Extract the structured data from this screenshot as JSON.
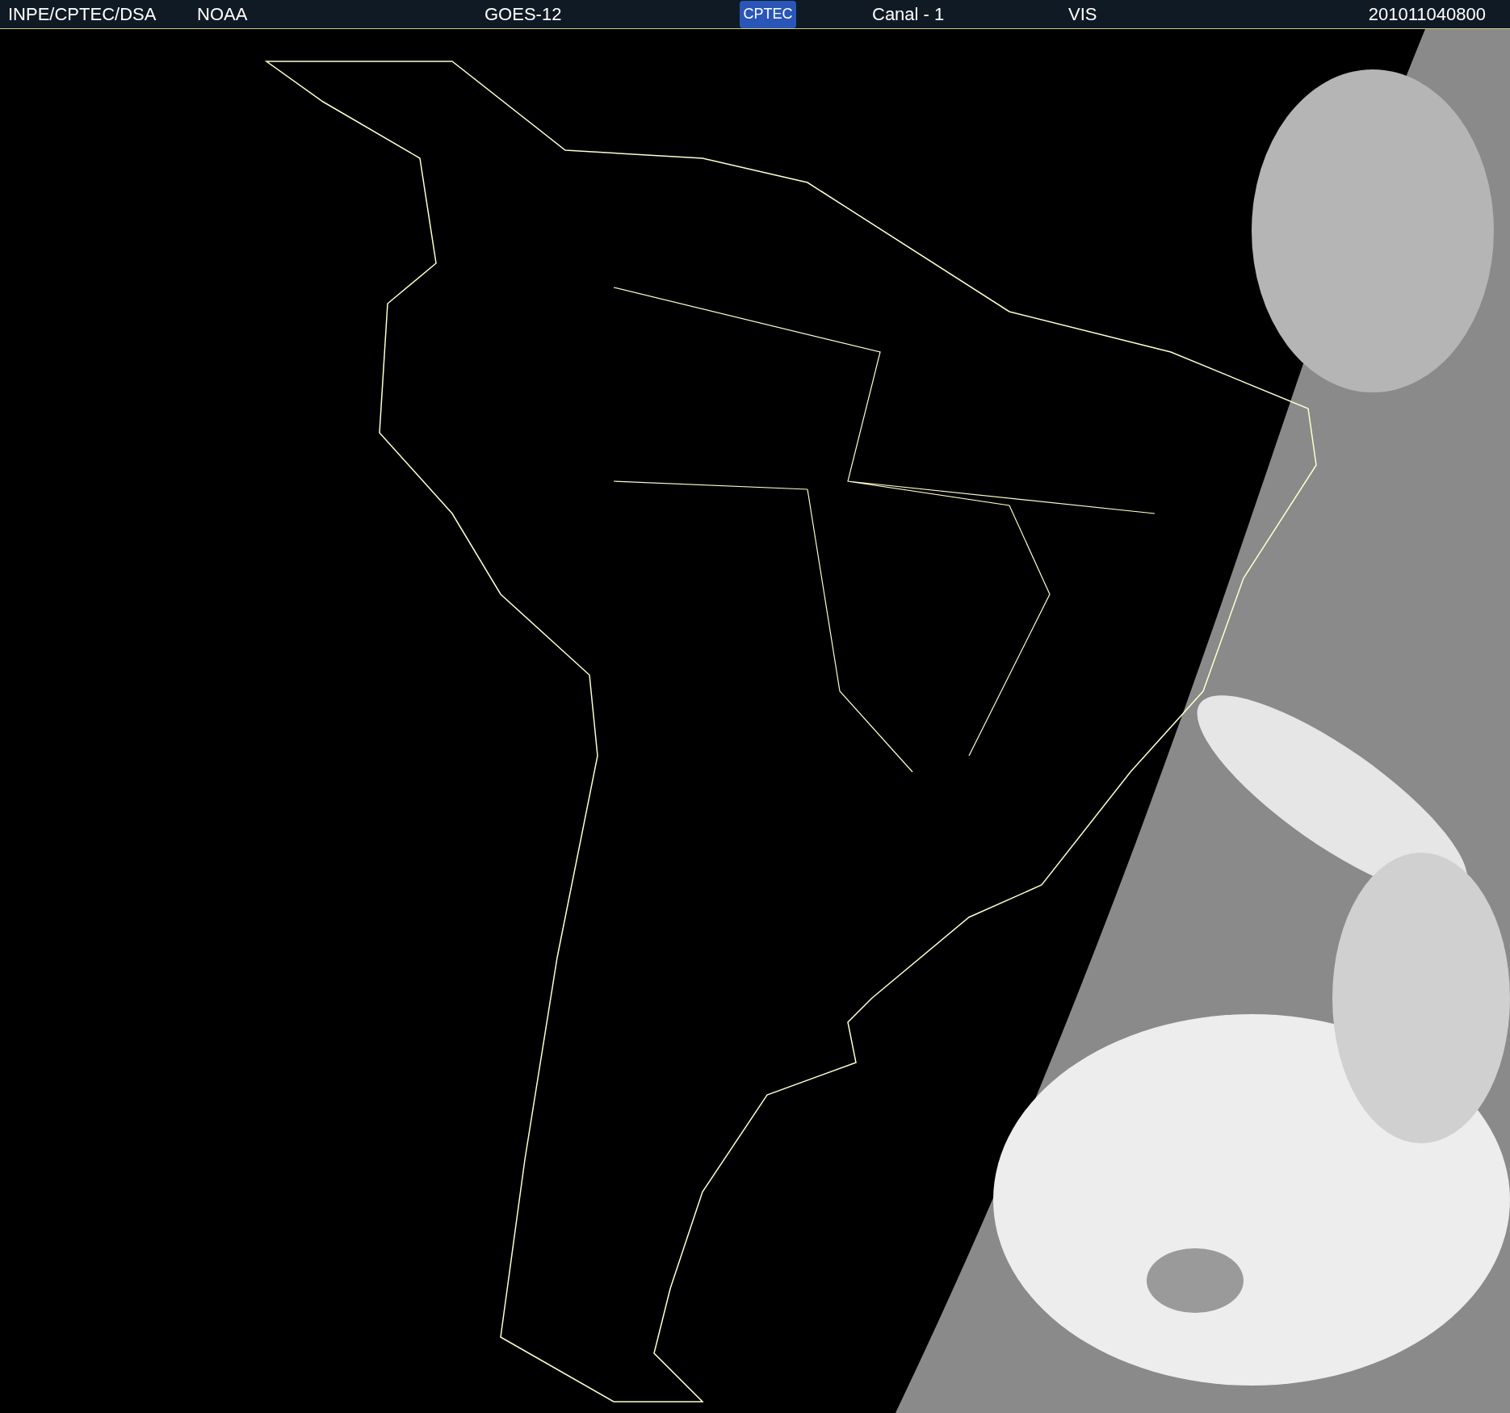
{
  "header": {
    "agency": "INPE/CPTEC/DSA",
    "source": "NOAA",
    "satellite": "GOES-12",
    "logo": "CPTEC",
    "channel": "Canal - 1",
    "band": "VIS",
    "timestamp": "201011040800"
  }
}
